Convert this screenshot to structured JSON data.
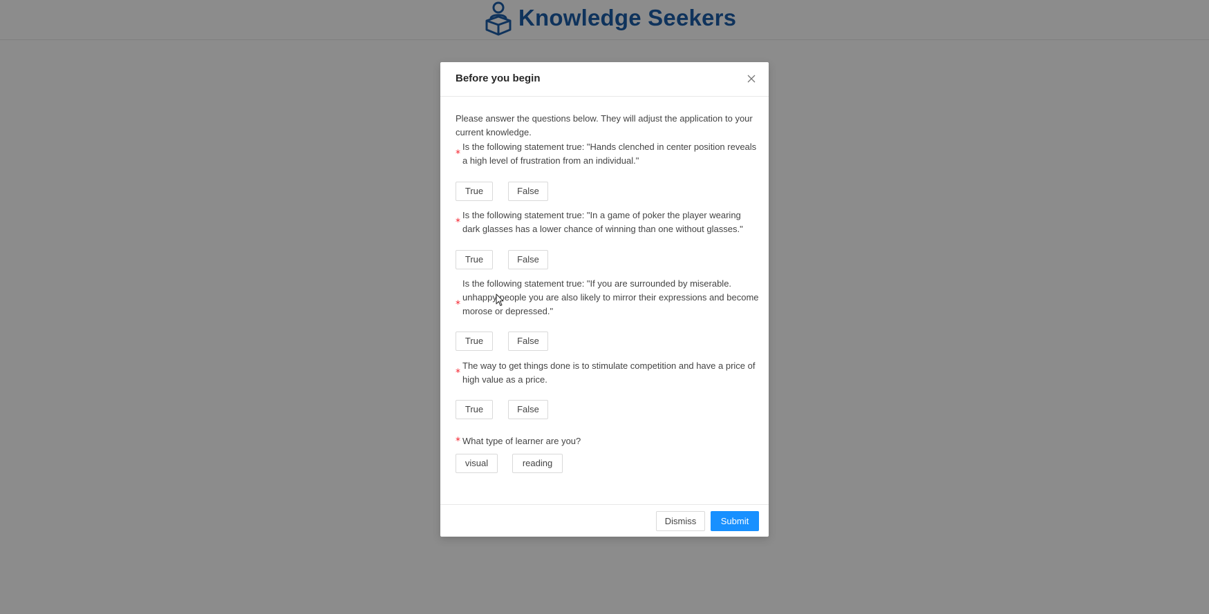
{
  "app": {
    "name": "Knowledge Seekers",
    "logo_icon": "person-with-book-icon",
    "brand_color": "#1c5da8"
  },
  "modal": {
    "title": "Before you begin",
    "close_icon": "close-icon",
    "intro": "Please answer the questions below. They will adjust the application to your current knowledge.",
    "questions": [
      {
        "label": "Is the following statement true: \"Hands clenched in center position reveals a high level of frustration from an individual.\"",
        "required": "*",
        "options": [
          "True",
          "False"
        ]
      },
      {
        "label": "Is the following statement true: \"In a game of poker the player wearing dark glasses has a lower chance of winning than one without glasses.\"",
        "required": "*",
        "options": [
          "True",
          "False"
        ]
      },
      {
        "label": "Is the following statement true: \"If you are surrounded by miserable. unhappy people you are also likely to mirror their expressions and become morose or depressed.\"",
        "required": "*",
        "options": [
          "True",
          "False"
        ]
      },
      {
        "label": "The way to get things done is to stimulate competition and have a price of high value as a price.",
        "required": "*",
        "options": [
          "True",
          "False"
        ]
      },
      {
        "label": "What type of learner are you?",
        "required": "*",
        "options": [
          "visual",
          "reading"
        ]
      }
    ],
    "footer": {
      "dismiss_label": "Dismiss",
      "submit_label": "Submit"
    }
  },
  "colors": {
    "primary": "#1890ff",
    "required": "#f5222d",
    "overlay": "rgba(0,0,0,0.45)"
  }
}
